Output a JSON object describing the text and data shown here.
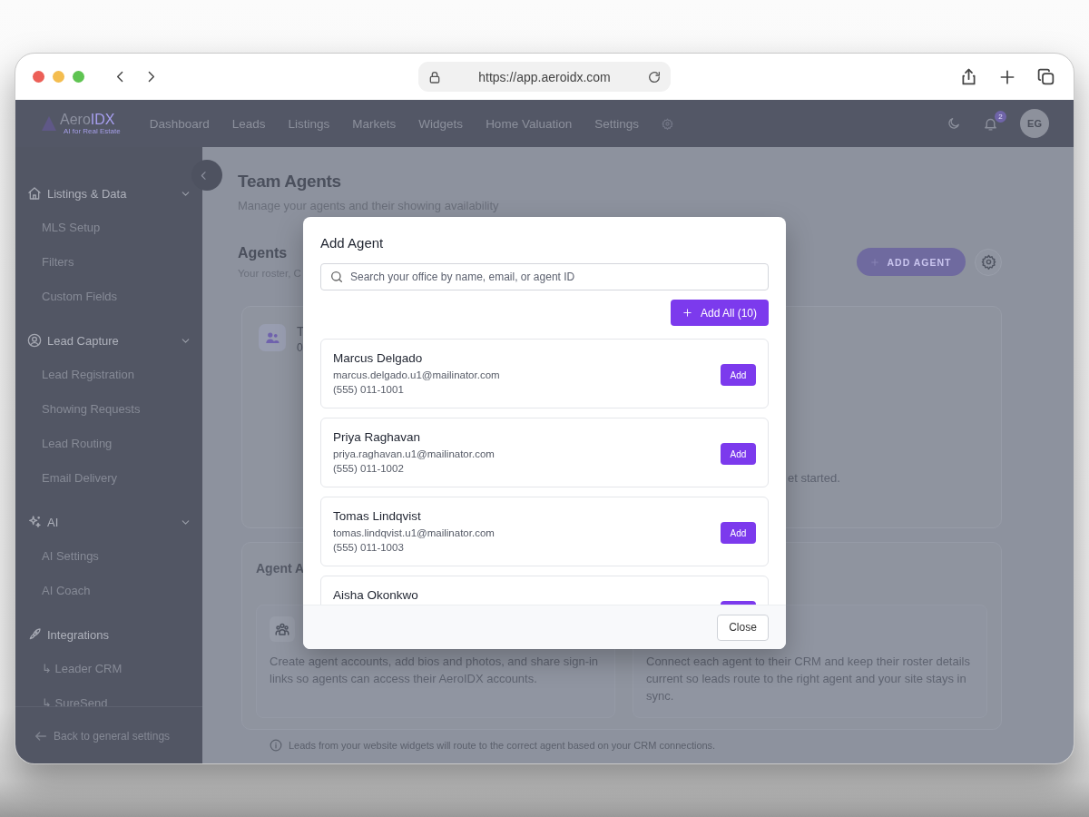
{
  "browser": {
    "url": "https://app.aeroidx.com"
  },
  "nav": {
    "logo": {
      "part_1": "Aero",
      "part_2": "IDX",
      "tagline": "AI for Real Estate"
    },
    "items": [
      {
        "label": "Dashboard"
      },
      {
        "label": "Leads"
      },
      {
        "label": "Listings"
      },
      {
        "label": "Markets"
      },
      {
        "label": "Widgets"
      },
      {
        "label": "Home Valuation"
      },
      {
        "label": "Settings"
      }
    ],
    "notification_count": "2",
    "avatar": "EG"
  },
  "sidebar": {
    "groups": [
      {
        "label": "Listings & Data",
        "expandable": true,
        "items": [
          "MLS Setup",
          "Filters",
          "Custom Fields"
        ]
      },
      {
        "label": "Lead Capture",
        "expandable": true,
        "items": [
          "Lead Registration",
          "Showing Requests",
          "Lead Routing",
          "Email Delivery"
        ]
      },
      {
        "label": "AI",
        "expandable": true,
        "items": [
          "AI Settings",
          "AI Coach"
        ]
      },
      {
        "label": "Integrations",
        "expandable": false,
        "items": [
          "↳ Leader CRM",
          "↳ SureSend"
        ]
      }
    ],
    "back_link": "Back to general settings"
  },
  "page": {
    "title": "Team Agents",
    "subtitle": "Manage your agents and their showing availability",
    "agents_section": {
      "title": "Agents",
      "subtitle": "Your roster, C",
      "add_button": "ADD AGENT",
      "roster_card": {
        "line_1": "T",
        "line_2": "0",
        "empty_text": "et started."
      }
    },
    "info_section": {
      "title": "Agent A",
      "cards": [
        {
          "text": "Create agent accounts, add bios and photos, and share sign-in links so agents can access their AeroIDX accounts."
        },
        {
          "text": "Connect each agent to their CRM and keep their roster details current so leads route to the right agent and your site stays in sync."
        }
      ]
    },
    "footnote": "Leads from your website widgets will route to the correct agent based on your CRM connections."
  },
  "modal": {
    "title": "Add Agent",
    "search_placeholder": "Search your office by name, email, or agent ID",
    "add_all_button": "Add All (10)",
    "agents": [
      {
        "name": "Marcus Delgado",
        "email": "marcus.delgado.u1@mailinator.com",
        "phone": "(555) 011-1001",
        "button": "Add"
      },
      {
        "name": "Priya Raghavan",
        "email": "priya.raghavan.u1@mailinator.com",
        "phone": "(555) 011-1002",
        "button": "Add"
      },
      {
        "name": "Tomas Lindqvist",
        "email": "tomas.lindqvist.u1@mailinator.com",
        "phone": "(555) 011-1003",
        "button": "Add"
      },
      {
        "name": "Aisha Okonkwo"
      }
    ],
    "close_button": "Close"
  }
}
